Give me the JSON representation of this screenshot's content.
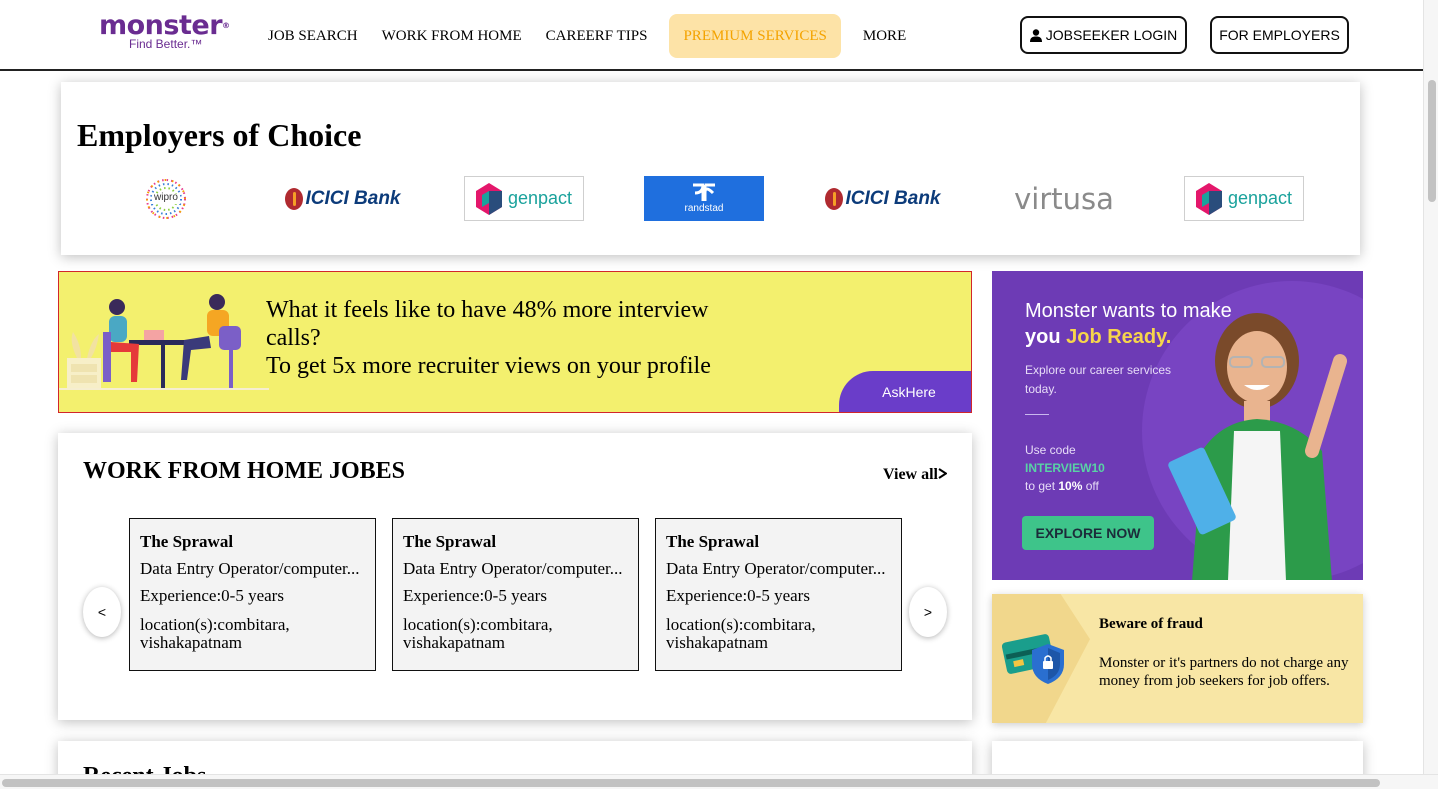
{
  "header": {
    "logo_word": "monster",
    "logo_reg": "®",
    "logo_tagline": "Find Better.™",
    "nav": [
      {
        "label": "JOB SEARCH"
      },
      {
        "label": "WORK FROM HOME"
      },
      {
        "label": "CAREERF TIPS"
      },
      {
        "label": "PREMIUM SERVICES"
      },
      {
        "label": "MORE"
      }
    ],
    "login_label": "JOBSEEKER LOGIN",
    "employers_label": "FOR EMPLOYERS"
  },
  "employers": {
    "title": "Employers of Choice",
    "logos": [
      {
        "name": "wipro",
        "text": "wipro"
      },
      {
        "name": "icici-bank",
        "text": "ICICI Bank"
      },
      {
        "name": "genpact",
        "text": "genpact"
      },
      {
        "name": "randstad",
        "text": "randstad"
      },
      {
        "name": "icici-bank",
        "text": "ICICI Bank"
      },
      {
        "name": "virtusa",
        "text": "virtusa"
      },
      {
        "name": "genpact",
        "text": "genpact"
      }
    ]
  },
  "promo": {
    "line1": "What it feels like to have 48% more interview",
    "line2": "calls?",
    "line3": "To get 5x more recruiter views on your profile",
    "cta": "AskHere"
  },
  "wfh": {
    "title": "WORK FROM HOME JOBES",
    "view_all": "View all",
    "view_all_icon": "chevron-right",
    "prev": "<",
    "next": ">",
    "jobs": [
      {
        "company": "The Sprawal",
        "role": "Data Entry Operator/computer...",
        "experience": "Experience:0-5 years",
        "location_line1": "location(s):combitara,",
        "location_line2": "vishakapatnam"
      },
      {
        "company": "The Sprawal",
        "role": "Data Entry Operator/computer...",
        "experience": "Experience:0-5 years",
        "location_line1": "location(s):combitara,",
        "location_line2": "vishakapatnam"
      },
      {
        "company": "The Sprawal",
        "role": "Data Entry Operator/computer...",
        "experience": "Experience:0-5 years",
        "location_line1": "location(s):combitara,",
        "location_line2": "vishakapatnam"
      }
    ]
  },
  "ad": {
    "title_line1": "Monster wants to make",
    "title_you": "you",
    "title_job_ready": "Job Ready.",
    "sub_line1": "Explore our career services",
    "sub_line2": "today.",
    "code_line1": "Use code",
    "code": "INTERVIEW10",
    "code_line3_pre": "to get",
    "code_discount": "10%",
    "code_line3_post": "off",
    "cta": "EXPLORE NOW"
  },
  "fraud": {
    "title": "Beware of fraud",
    "text": "Monster or it's partners do not charge any money from job seekers for job offers."
  },
  "bottom": {
    "title": "Recent Jobs"
  },
  "colors": {
    "brand_purple": "#6a2c91",
    "premium_bg": "#fde3a7",
    "premium_text": "#f4a300",
    "promo_bg": "#f3f06e",
    "askhere_bg": "#6a3dc9",
    "ad_bg": "#6d3bb5",
    "explore_bg": "#3ec48a",
    "fraud_bg": "#f8e6a5"
  }
}
